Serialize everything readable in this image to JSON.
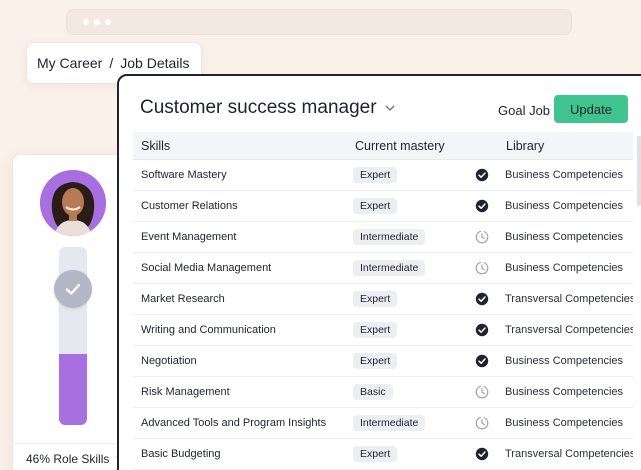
{
  "breadcrumb": {
    "root": "My Career",
    "separator": "/",
    "current": "Job Details"
  },
  "side_panel": {
    "role_skills_label": "46% Role Skills",
    "role_skills_progress": 0.4,
    "accent_color": "#a86fe0"
  },
  "header": {
    "job_title": "Customer success manager",
    "goal_label": "Goal Job",
    "update_label": "Update",
    "update_color": "#3fc38f"
  },
  "table": {
    "columns": {
      "skills": "Skills",
      "mastery": "Current mastery",
      "library": "Library"
    },
    "rows": [
      {
        "skill": "Software Mastery",
        "mastery": "Expert",
        "status": "check-circle-icon",
        "library": "Business Competencies"
      },
      {
        "skill": "Customer Relations",
        "mastery": "Expert",
        "status": "check-circle-icon",
        "library": "Business Competencies"
      },
      {
        "skill": "Event Management",
        "mastery": "Intermediate",
        "status": "clock-icon",
        "library": "Business Competencies"
      },
      {
        "skill": "Social Media Management",
        "mastery": "Intermediate",
        "status": "clock-icon",
        "library": "Business Competencies"
      },
      {
        "skill": "Market Research",
        "mastery": "Expert",
        "status": "check-circle-icon",
        "library": "Transversal Competencies"
      },
      {
        "skill": "Writing and Communication",
        "mastery": "Expert",
        "status": "check-circle-icon",
        "library": "Transversal Competencies"
      },
      {
        "skill": "Negotiation",
        "mastery": "Expert",
        "status": "check-circle-icon",
        "library": "Business Competencies"
      },
      {
        "skill": "Risk Management",
        "mastery": "Basic",
        "status": "clock-icon",
        "library": "Business Competencies"
      },
      {
        "skill": "Advanced Tools and Program Insights",
        "mastery": "Intermediate",
        "status": "clock-icon",
        "library": "Business Competencies"
      },
      {
        "skill": "Basic Budgeting",
        "mastery": "Expert",
        "status": "check-circle-icon",
        "library": "Transversal Competencies"
      }
    ]
  }
}
